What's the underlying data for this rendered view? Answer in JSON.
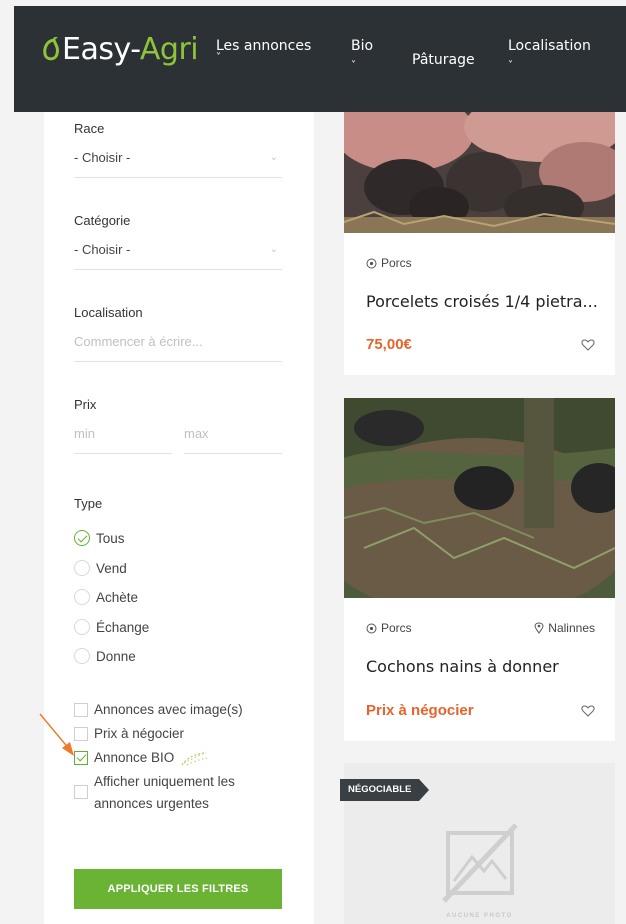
{
  "header": {
    "logo_prefix": "Easy-",
    "logo_suffix": "Agri",
    "nav": [
      {
        "label": "Les annonces",
        "chevron": "˅"
      },
      {
        "label": "Bio",
        "chevron": "˅"
      },
      {
        "label": "Pâturage",
        "chevron": ""
      },
      {
        "label": "Localisation",
        "chevron": "˅"
      }
    ]
  },
  "filters": {
    "race": {
      "label": "Race",
      "value": "- Choisir -"
    },
    "categorie": {
      "label": "Catégorie",
      "value": "- Choisir -"
    },
    "localisation": {
      "label": "Localisation",
      "placeholder": "Commencer à écrire..."
    },
    "prix": {
      "label": "Prix",
      "min_placeholder": "min",
      "max_placeholder": "max"
    },
    "type": {
      "label": "Type",
      "options": [
        {
          "label": "Tous",
          "selected": true
        },
        {
          "label": "Vend",
          "selected": false
        },
        {
          "label": "Achète",
          "selected": false
        },
        {
          "label": "Échange",
          "selected": false
        },
        {
          "label": "Donne",
          "selected": false
        }
      ]
    },
    "checkboxes": [
      {
        "label": "Annonces avec image(s)",
        "checked": false
      },
      {
        "label": "Prix à négocier",
        "checked": false
      },
      {
        "label": "Annonce BIO",
        "checked": true
      },
      {
        "label": "Afficher uniquement les annonces urgentes",
        "checked": false
      }
    ],
    "apply_label": "APPLIQUER LES FILTRES"
  },
  "listings": [
    {
      "category": "Porcs",
      "location": "",
      "title": "Porcelets croisés 1/4 pietra...",
      "price": "75,00€"
    },
    {
      "category": "Porcs",
      "location": "Nalinnes",
      "title": "Cochons nains à donner",
      "price": "Prix à négocier"
    },
    {
      "badge": "NÉGOCIABLE",
      "no_photo_text": "AUCUNE PHOTO"
    }
  ],
  "colors": {
    "header_bg": "#2c3136",
    "accent_green": "#6ab334",
    "price_orange": "#e8632b",
    "annotation_arrow": "#f07a2a"
  }
}
